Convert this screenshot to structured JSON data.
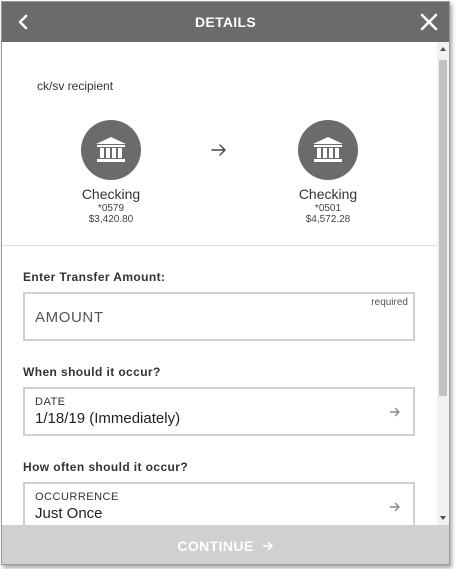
{
  "header": {
    "title": "DETAILS",
    "back_icon": "chevron-left-icon",
    "close_icon": "close-icon",
    "background": "#6b6b6b"
  },
  "transfer": {
    "recipient": "ck/sv recipient",
    "from": {
      "icon": "bank-icon",
      "type": "Checking",
      "number": "*0579",
      "balance": "$3,420.80"
    },
    "to": {
      "icon": "bank-icon",
      "type": "Checking",
      "number": "*0501",
      "balance": "$4,572.28"
    },
    "arrow_icon": "arrow-right-icon"
  },
  "amount": {
    "label": "Enter Transfer Amount:",
    "placeholder": "AMOUNT",
    "required": "required"
  },
  "date": {
    "section_label": "When should it occur?",
    "field_label": "DATE",
    "value": "1/18/19 (Immediately)"
  },
  "occurrence": {
    "section_label": "How often should it occur?",
    "field_label": "OCCURRENCE",
    "value": "Just Once"
  },
  "footer": {
    "continue_label": "CONTINUE",
    "background": "#d0d0d0"
  }
}
